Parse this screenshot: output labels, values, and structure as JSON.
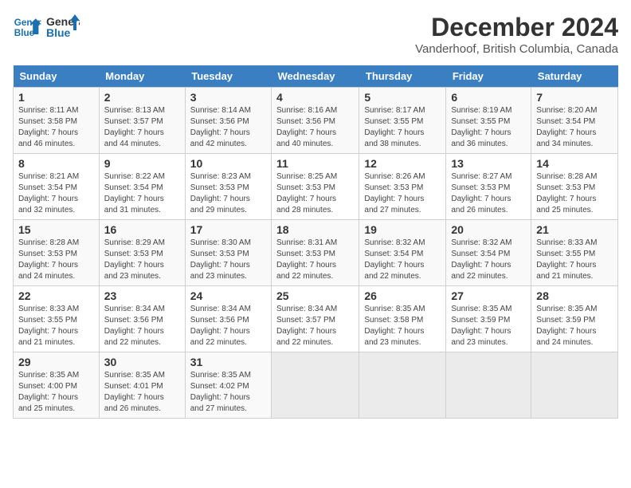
{
  "header": {
    "logo_line1": "General",
    "logo_line2": "Blue",
    "title": "December 2024",
    "subtitle": "Vanderhoof, British Columbia, Canada"
  },
  "weekdays": [
    "Sunday",
    "Monday",
    "Tuesday",
    "Wednesday",
    "Thursday",
    "Friday",
    "Saturday"
  ],
  "weeks": [
    [
      {
        "day": "1",
        "info": "Sunrise: 8:11 AM\nSunset: 3:58 PM\nDaylight: 7 hours\nand 46 minutes."
      },
      {
        "day": "2",
        "info": "Sunrise: 8:13 AM\nSunset: 3:57 PM\nDaylight: 7 hours\nand 44 minutes."
      },
      {
        "day": "3",
        "info": "Sunrise: 8:14 AM\nSunset: 3:56 PM\nDaylight: 7 hours\nand 42 minutes."
      },
      {
        "day": "4",
        "info": "Sunrise: 8:16 AM\nSunset: 3:56 PM\nDaylight: 7 hours\nand 40 minutes."
      },
      {
        "day": "5",
        "info": "Sunrise: 8:17 AM\nSunset: 3:55 PM\nDaylight: 7 hours\nand 38 minutes."
      },
      {
        "day": "6",
        "info": "Sunrise: 8:19 AM\nSunset: 3:55 PM\nDaylight: 7 hours\nand 36 minutes."
      },
      {
        "day": "7",
        "info": "Sunrise: 8:20 AM\nSunset: 3:54 PM\nDaylight: 7 hours\nand 34 minutes."
      }
    ],
    [
      {
        "day": "8",
        "info": "Sunrise: 8:21 AM\nSunset: 3:54 PM\nDaylight: 7 hours\nand 32 minutes."
      },
      {
        "day": "9",
        "info": "Sunrise: 8:22 AM\nSunset: 3:54 PM\nDaylight: 7 hours\nand 31 minutes."
      },
      {
        "day": "10",
        "info": "Sunrise: 8:23 AM\nSunset: 3:53 PM\nDaylight: 7 hours\nand 29 minutes."
      },
      {
        "day": "11",
        "info": "Sunrise: 8:25 AM\nSunset: 3:53 PM\nDaylight: 7 hours\nand 28 minutes."
      },
      {
        "day": "12",
        "info": "Sunrise: 8:26 AM\nSunset: 3:53 PM\nDaylight: 7 hours\nand 27 minutes."
      },
      {
        "day": "13",
        "info": "Sunrise: 8:27 AM\nSunset: 3:53 PM\nDaylight: 7 hours\nand 26 minutes."
      },
      {
        "day": "14",
        "info": "Sunrise: 8:28 AM\nSunset: 3:53 PM\nDaylight: 7 hours\nand 25 minutes."
      }
    ],
    [
      {
        "day": "15",
        "info": "Sunrise: 8:28 AM\nSunset: 3:53 PM\nDaylight: 7 hours\nand 24 minutes."
      },
      {
        "day": "16",
        "info": "Sunrise: 8:29 AM\nSunset: 3:53 PM\nDaylight: 7 hours\nand 23 minutes."
      },
      {
        "day": "17",
        "info": "Sunrise: 8:30 AM\nSunset: 3:53 PM\nDaylight: 7 hours\nand 23 minutes."
      },
      {
        "day": "18",
        "info": "Sunrise: 8:31 AM\nSunset: 3:53 PM\nDaylight: 7 hours\nand 22 minutes."
      },
      {
        "day": "19",
        "info": "Sunrise: 8:32 AM\nSunset: 3:54 PM\nDaylight: 7 hours\nand 22 minutes."
      },
      {
        "day": "20",
        "info": "Sunrise: 8:32 AM\nSunset: 3:54 PM\nDaylight: 7 hours\nand 22 minutes."
      },
      {
        "day": "21",
        "info": "Sunrise: 8:33 AM\nSunset: 3:55 PM\nDaylight: 7 hours\nand 21 minutes."
      }
    ],
    [
      {
        "day": "22",
        "info": "Sunrise: 8:33 AM\nSunset: 3:55 PM\nDaylight: 7 hours\nand 21 minutes."
      },
      {
        "day": "23",
        "info": "Sunrise: 8:34 AM\nSunset: 3:56 PM\nDaylight: 7 hours\nand 22 minutes."
      },
      {
        "day": "24",
        "info": "Sunrise: 8:34 AM\nSunset: 3:56 PM\nDaylight: 7 hours\nand 22 minutes."
      },
      {
        "day": "25",
        "info": "Sunrise: 8:34 AM\nSunset: 3:57 PM\nDaylight: 7 hours\nand 22 minutes."
      },
      {
        "day": "26",
        "info": "Sunrise: 8:35 AM\nSunset: 3:58 PM\nDaylight: 7 hours\nand 23 minutes."
      },
      {
        "day": "27",
        "info": "Sunrise: 8:35 AM\nSunset: 3:59 PM\nDaylight: 7 hours\nand 23 minutes."
      },
      {
        "day": "28",
        "info": "Sunrise: 8:35 AM\nSunset: 3:59 PM\nDaylight: 7 hours\nand 24 minutes."
      }
    ],
    [
      {
        "day": "29",
        "info": "Sunrise: 8:35 AM\nSunset: 4:00 PM\nDaylight: 7 hours\nand 25 minutes."
      },
      {
        "day": "30",
        "info": "Sunrise: 8:35 AM\nSunset: 4:01 PM\nDaylight: 7 hours\nand 26 minutes."
      },
      {
        "day": "31",
        "info": "Sunrise: 8:35 AM\nSunset: 4:02 PM\nDaylight: 7 hours\nand 27 minutes."
      },
      null,
      null,
      null,
      null
    ]
  ]
}
